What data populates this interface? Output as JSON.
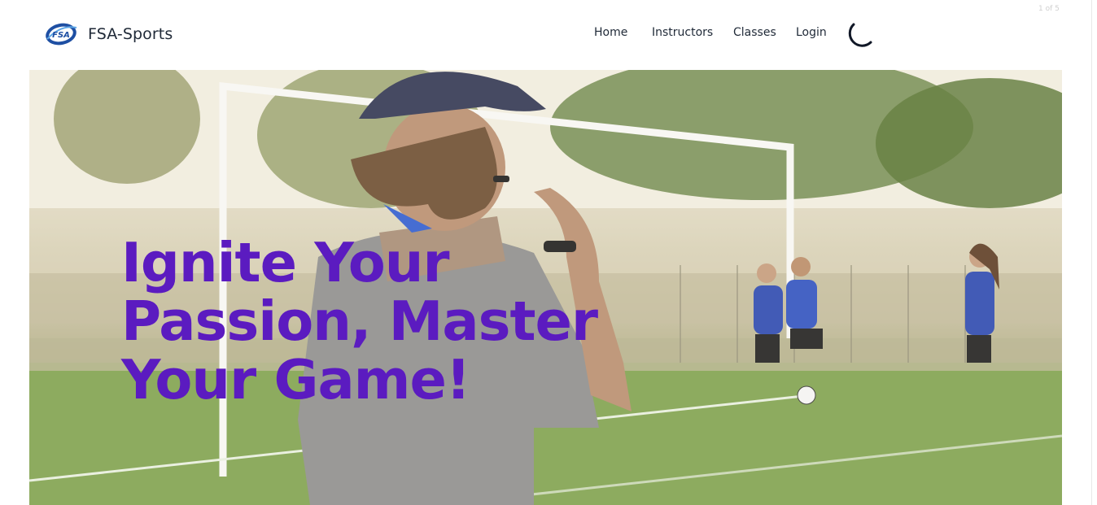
{
  "brand": {
    "name": "FSA-Sports",
    "logo_text": "FSA"
  },
  "nav": {
    "items": [
      {
        "label": "Home"
      },
      {
        "label": "Instructors"
      },
      {
        "label": "Classes"
      },
      {
        "label": "Login"
      }
    ],
    "theme_toggle_icon": "moon-icon"
  },
  "carousel": {
    "counter": "1 of 5",
    "current_slide": 1,
    "total_slides": 5,
    "next_icon": "chevron-right-icon"
  },
  "hero": {
    "title": "Ignite Your Passion, Master Your Game!"
  },
  "colors": {
    "accent": "#5b1bc0",
    "text": "#1f2937",
    "logo_blue": "#1e4fa3"
  }
}
